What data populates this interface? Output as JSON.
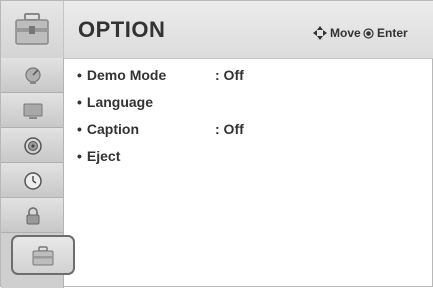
{
  "header": {
    "title": "OPTION",
    "move_label": "Move",
    "enter_label": "Enter"
  },
  "menu": {
    "bullet": "•",
    "items": [
      {
        "label": "Demo Mode",
        "value": ": Off"
      },
      {
        "label": "Language",
        "value": ""
      },
      {
        "label": "Caption",
        "value": ": Off"
      },
      {
        "label": "Eject",
        "value": ""
      }
    ]
  },
  "sidebar": {
    "items": [
      {
        "icon": "satellite-dish-icon"
      },
      {
        "icon": "monitor-icon"
      },
      {
        "icon": "speaker-icon"
      },
      {
        "icon": "clock-icon"
      },
      {
        "icon": "lock-icon"
      },
      {
        "icon": "option-toolbox-icon",
        "selected": true
      }
    ]
  },
  "colors": {
    "text": "#333333",
    "header_bg": "#dcdcdc",
    "sidebar_bg": "#cfcfcf",
    "selected_border": "#6e6e6e"
  }
}
